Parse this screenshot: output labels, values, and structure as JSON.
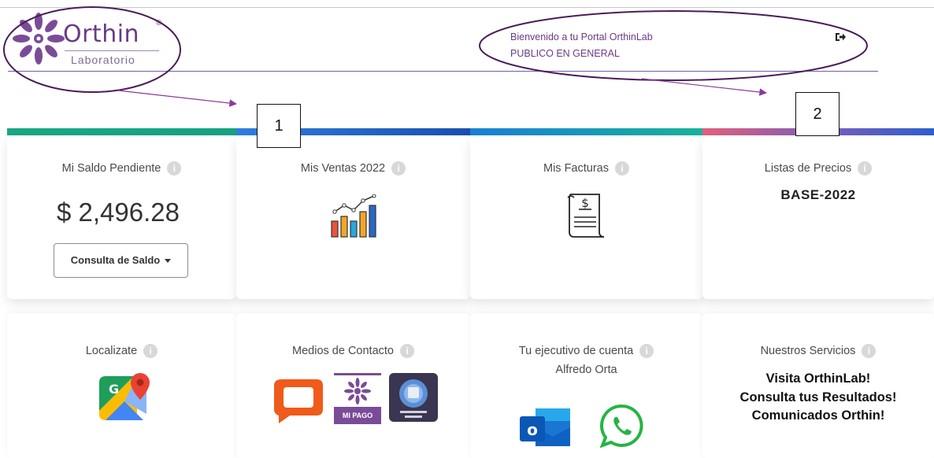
{
  "header": {
    "logo_name": "Orthin",
    "logo_registered": "®",
    "logo_subtitle": "Laboratorio",
    "welcome_line": "Bienvenido a tu Portal OrthinLab",
    "user_group": "PUBLICO EN GENERAL",
    "logout_icon": "sign-out-icon"
  },
  "annotations": {
    "label_1": "1",
    "label_2": "2"
  },
  "colors": {
    "brand_purple": "#6a3b86",
    "bar_green": "#1aa588",
    "bar_blue": "#1f5fbf",
    "bar_pink": "#e0607a"
  },
  "cards_row1": {
    "saldo": {
      "title": "Mi Saldo Pendiente",
      "amount": "$ 2,496.28",
      "button": "Consulta de Saldo"
    },
    "ventas": {
      "title": "Mis Ventas 2022",
      "icon": "bar-chart-icon"
    },
    "facturas": {
      "title": "Mis Facturas",
      "icon": "invoice-icon"
    },
    "precios": {
      "title": "Listas de Precios",
      "value": "BASE-2022"
    }
  },
  "cards_row2": {
    "localizate": {
      "title": "Localizate",
      "icon": "google-maps-icon"
    },
    "contacto": {
      "title": "Medios de Contacto",
      "icons": [
        "chat-icon",
        "mi-pago-icon",
        "app-icon"
      ],
      "mi_pago_label": "MI PAGO"
    },
    "ejecutivo": {
      "title": "Tu ejecutivo de cuenta",
      "name": "Alfredo Orta",
      "icons": [
        "outlook-icon",
        "whatsapp-icon"
      ]
    },
    "servicios": {
      "title": "Nuestros Servicios",
      "links": [
        "Visita OrthinLab!",
        "Consulta tus Resultados!",
        "Comunicados Orthin!"
      ]
    }
  }
}
